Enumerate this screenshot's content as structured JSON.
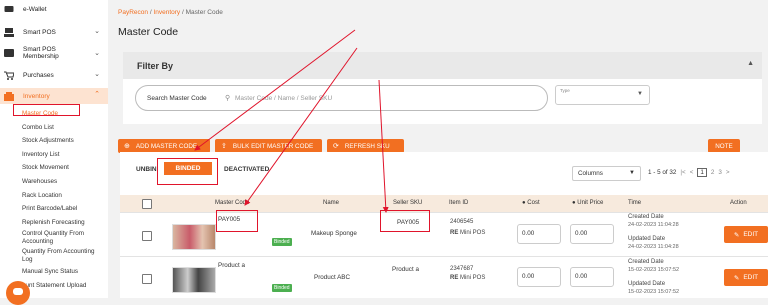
{
  "sidebar": {
    "items": [
      {
        "label": "e-Wallet",
        "icon": "wallet-icon"
      },
      {
        "label": "Smart POS",
        "icon": "pos-icon",
        "chevron": "⌄"
      },
      {
        "label": "Smart POS Membership",
        "icon": "membership-icon",
        "chevron": "⌄"
      },
      {
        "label": "Purchases",
        "icon": "cart-icon",
        "chevron": "⌄"
      },
      {
        "label": "Inventory",
        "icon": "inventory-icon",
        "chevron": "⌃"
      }
    ],
    "sub_items": [
      "Master Code",
      "Combo List",
      "Stock Adjustments",
      "Inventory List",
      "Stock Movement",
      "Warehouses",
      "Rack Location",
      "Print Barcode/Label",
      "Replenish Forecasting",
      "Control Quantity From Accounting",
      "Quantity From Accounting Log",
      "Manual Sync Status",
      "ount Statement Upload"
    ]
  },
  "breadcrumb": {
    "root": "PayRecon",
    "sep": "/",
    "mid": "Inventory",
    "current": "Master Code"
  },
  "page_title": "Master Code",
  "filter": {
    "title": "Filter By",
    "search_label": "Search Master Code",
    "search_placeholder": "Master Code / Name / Seller SKU",
    "type_label": "Type"
  },
  "toolbar": {
    "add": "ADD MASTER CODE",
    "bulk": "BULK EDIT MASTER CODE",
    "refresh": "REFRESH SKU",
    "note": "NOTE"
  },
  "tabs": {
    "unbinded": "UNBINDED",
    "binded": "BINDED",
    "deactivated": "DEACTIVATED"
  },
  "columns_select": "Columns",
  "pagination": {
    "range": "1 - 5 of 32",
    "pages": [
      "1",
      "2",
      "3"
    ]
  },
  "table": {
    "headers": [
      "Master Code",
      "Name",
      "Seller SKU",
      "Item ID",
      "Cost",
      "Unit Price",
      "Time",
      "Action"
    ],
    "rows": [
      {
        "master_code": "PAY005",
        "badge": "Binded",
        "name": "Makeup Sponge",
        "seller_sku": "PAY005",
        "item_id": "2406545",
        "item_store": "Mini POS",
        "cost": "0.00",
        "unit_price": "0.00",
        "created_label": "Created Date",
        "created": "24-02-2023 11:04:28",
        "updated_label": "Updated Date",
        "updated": "24-02-2023 11:04:28",
        "action": "EDIT"
      },
      {
        "master_code": "Product a",
        "badge": "Binded",
        "name": "Product ABC",
        "seller_sku": "Product a",
        "item_id": "2347687",
        "item_store": "Mini POS",
        "cost": "0.00",
        "unit_price": "0.00",
        "created_label": "Created Date",
        "created": "15-02-2023 15:07:52",
        "updated_label": "Updated Date",
        "updated": "15-02-2023 15:07:52",
        "action": "EDIT"
      }
    ]
  },
  "colors": {
    "accent": "#f26f21",
    "annotation": "#e0142b",
    "badge": "#4caf50"
  }
}
